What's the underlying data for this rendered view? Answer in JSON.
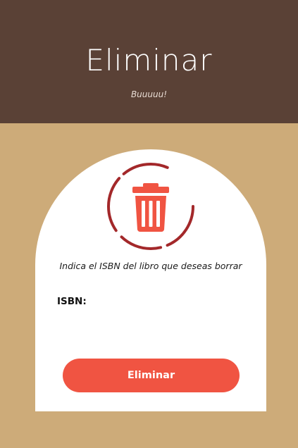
{
  "header": {
    "title": "Eliminar",
    "subtitle": "Buuuuu!"
  },
  "colors": {
    "header_background": "#5a4136",
    "page_background": "#cdab79",
    "card_background": "#ffffff",
    "accent": "#f05442",
    "icon_ring": "#a3282a"
  },
  "form": {
    "icon": "trash-can-icon",
    "instruction": "Indica el ISBN del libro que deseas borrar",
    "isbn_label": "ISBN:",
    "isbn_value": "",
    "submit_label": "Eliminar"
  }
}
